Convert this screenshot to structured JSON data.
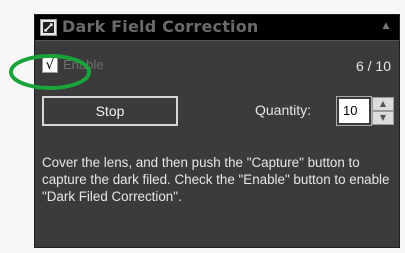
{
  "dialog": {
    "title": "Dark Field Correction",
    "icon": "dark-field-correction-icon",
    "collapse_glyph": "▲"
  },
  "enable": {
    "checked_glyph": "√",
    "label": "Enable",
    "checked": true
  },
  "progress": {
    "text": "6 / 10"
  },
  "stop_button": {
    "label": "Stop"
  },
  "quantity": {
    "label": "Quantity:",
    "value": "10"
  },
  "description": {
    "text": "Cover the lens, and then push the \"Capture\" button to capture the dark filed. Check the \"Enable\" button to enable \"Dark Filed Correction\"."
  },
  "annotation": {
    "highlight_color": "#1aa33a"
  }
}
